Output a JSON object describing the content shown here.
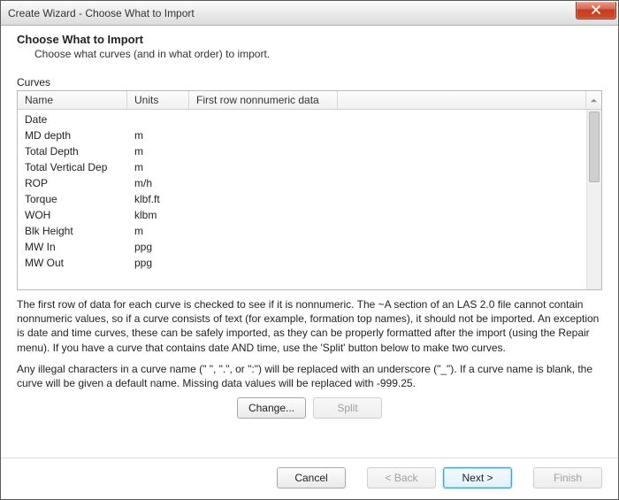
{
  "window": {
    "title": "Create Wizard - Choose What to Import"
  },
  "header": {
    "heading": "Choose What to Import",
    "sub": "Choose what curves (and in what order) to import."
  },
  "curves": {
    "section_label": "Curves",
    "columns": {
      "name": "Name",
      "units": "Units",
      "firstrow": "First row nonnumeric data"
    },
    "rows": [
      {
        "name": "Date",
        "units": ""
      },
      {
        "name": "MD depth",
        "units": "m"
      },
      {
        "name": "Total Depth",
        "units": "m"
      },
      {
        "name": "Total Vertical Dep",
        "units": "m"
      },
      {
        "name": "ROP",
        "units": "m/h"
      },
      {
        "name": "Torque",
        "units": "klbf.ft"
      },
      {
        "name": "WOH",
        "units": "klbm"
      },
      {
        "name": "Blk Height",
        "units": "m"
      },
      {
        "name": "MW In",
        "units": "ppg"
      },
      {
        "name": "MW Out",
        "units": "ppg"
      }
    ]
  },
  "paragraphs": {
    "p1": "The first row of data for each curve is checked to see if it is nonnumeric. The ~A section of an LAS 2.0 file cannot contain nonnumeric values, so if a curve consists of text (for example, formation top names), it should not be imported. An exception is date and time curves, these can be safely imported, as they can be properly formatted after the import (using the Repair menu). If you have a curve that contains date AND time, use the 'Split' button below to make two curves.",
    "p2": "Any illegal characters in a curve name (\" \", \".\", or \":\") will be replaced with an underscore (\"_\"). If a curve name is blank, the curve will be given a default name. Missing data values will be replaced with -999.25."
  },
  "buttons": {
    "change": "Change...",
    "split": "Split",
    "cancel": "Cancel",
    "back": "< Back",
    "next": "Next >",
    "finish": "Finish"
  }
}
